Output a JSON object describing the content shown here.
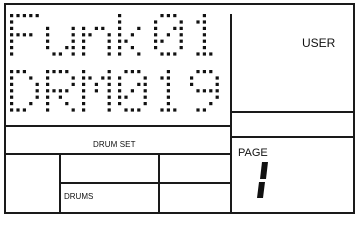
{
  "display": {
    "line1": "Funk01",
    "line2": "DRM019",
    "user_label": "USER",
    "drum_set_label": "DRUM SET",
    "page_label": "PAGE",
    "page_number": "1",
    "drums_label": "DRUMS"
  }
}
